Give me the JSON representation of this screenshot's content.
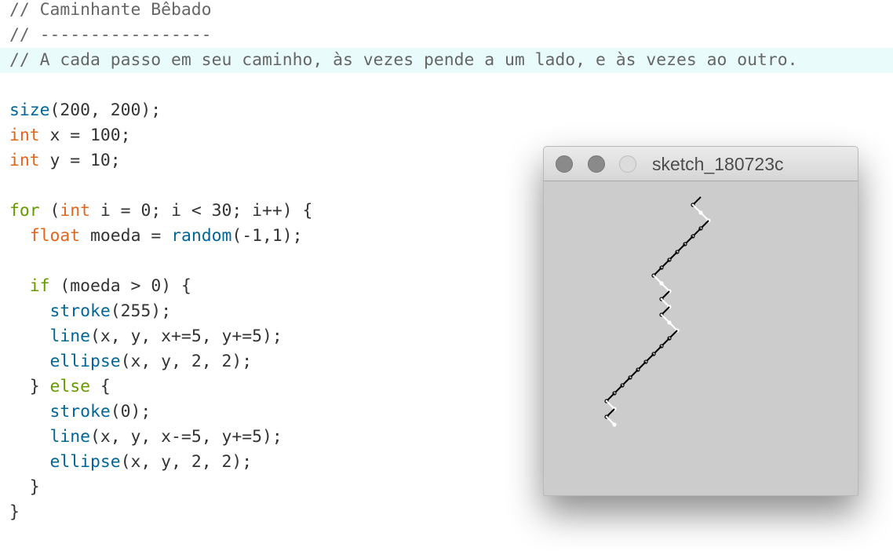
{
  "code": {
    "lines": [
      {
        "highlight": false,
        "tokens": [
          {
            "t": "// Caminhante Bêbado",
            "k": "comment"
          }
        ]
      },
      {
        "highlight": false,
        "tokens": [
          {
            "t": "// -----------------",
            "k": "comment"
          }
        ]
      },
      {
        "highlight": true,
        "tokens": [
          {
            "t": "// A cada passo em seu caminho, às vezes pende a um lado, e às vezes ao outro.",
            "k": "comment"
          }
        ]
      },
      {
        "highlight": false,
        "tokens": []
      },
      {
        "highlight": false,
        "tokens": [
          {
            "t": "size",
            "k": "func"
          },
          {
            "t": "(200, 200);",
            "k": "plain"
          }
        ]
      },
      {
        "highlight": false,
        "tokens": [
          {
            "t": "int",
            "k": "type"
          },
          {
            "t": " x = 100;",
            "k": "plain"
          }
        ]
      },
      {
        "highlight": false,
        "tokens": [
          {
            "t": "int",
            "k": "type"
          },
          {
            "t": " y = 10;",
            "k": "plain"
          }
        ]
      },
      {
        "highlight": false,
        "tokens": []
      },
      {
        "highlight": false,
        "tokens": [
          {
            "t": "for",
            "k": "ctrl"
          },
          {
            "t": " (",
            "k": "plain"
          },
          {
            "t": "int",
            "k": "type"
          },
          {
            "t": " i = 0; i < 30; i++) {",
            "k": "plain"
          }
        ]
      },
      {
        "highlight": false,
        "tokens": [
          {
            "t": "  ",
            "k": "plain"
          },
          {
            "t": "float",
            "k": "type"
          },
          {
            "t": " moeda = ",
            "k": "plain"
          },
          {
            "t": "random",
            "k": "func"
          },
          {
            "t": "(-1,1);",
            "k": "plain"
          }
        ]
      },
      {
        "highlight": false,
        "tokens": []
      },
      {
        "highlight": false,
        "tokens": [
          {
            "t": "  ",
            "k": "plain"
          },
          {
            "t": "if",
            "k": "ctrl"
          },
          {
            "t": " (moeda > 0) {",
            "k": "plain"
          }
        ]
      },
      {
        "highlight": false,
        "tokens": [
          {
            "t": "    ",
            "k": "plain"
          },
          {
            "t": "stroke",
            "k": "func"
          },
          {
            "t": "(255);",
            "k": "plain"
          }
        ]
      },
      {
        "highlight": false,
        "tokens": [
          {
            "t": "    ",
            "k": "plain"
          },
          {
            "t": "line",
            "k": "func"
          },
          {
            "t": "(x, y, x+=5, y+=5);",
            "k": "plain"
          }
        ]
      },
      {
        "highlight": false,
        "tokens": [
          {
            "t": "    ",
            "k": "plain"
          },
          {
            "t": "ellipse",
            "k": "func"
          },
          {
            "t": "(x, y, 2, 2);",
            "k": "plain"
          }
        ]
      },
      {
        "highlight": false,
        "tokens": [
          {
            "t": "  } ",
            "k": "plain"
          },
          {
            "t": "else",
            "k": "ctrl"
          },
          {
            "t": " {",
            "k": "plain"
          }
        ]
      },
      {
        "highlight": false,
        "tokens": [
          {
            "t": "    ",
            "k": "plain"
          },
          {
            "t": "stroke",
            "k": "func"
          },
          {
            "t": "(0);",
            "k": "plain"
          }
        ]
      },
      {
        "highlight": false,
        "tokens": [
          {
            "t": "    ",
            "k": "plain"
          },
          {
            "t": "line",
            "k": "func"
          },
          {
            "t": "(x, y, x-=5, y+=5);",
            "k": "plain"
          }
        ]
      },
      {
        "highlight": false,
        "tokens": [
          {
            "t": "    ",
            "k": "plain"
          },
          {
            "t": "ellipse",
            "k": "func"
          },
          {
            "t": "(x, y, 2, 2);",
            "k": "plain"
          }
        ]
      },
      {
        "highlight": false,
        "tokens": [
          {
            "t": "  }",
            "k": "plain"
          }
        ]
      },
      {
        "highlight": false,
        "tokens": [
          {
            "t": "}",
            "k": "plain"
          }
        ]
      }
    ]
  },
  "sketch_window": {
    "title": "sketch_180723c",
    "canvas_background": "#cccccc",
    "walk": {
      "start": [
        100,
        10
      ],
      "step_size": 5,
      "steps": [
        -1,
        1,
        1,
        -1,
        -1,
        -1,
        -1,
        -1,
        -1,
        -1,
        1,
        1,
        -1,
        1,
        -1,
        1,
        1,
        -1,
        -1,
        -1,
        -1,
        -1,
        -1,
        -1,
        -1,
        -1,
        1,
        -1,
        1,
        0
      ]
    }
  },
  "colors": {
    "comment": "#666666",
    "type_keyword": "#e2661a",
    "control_keyword": "#669900",
    "function": "#006699",
    "plain": "#333333",
    "highlight_line": "#e9fbfb"
  }
}
